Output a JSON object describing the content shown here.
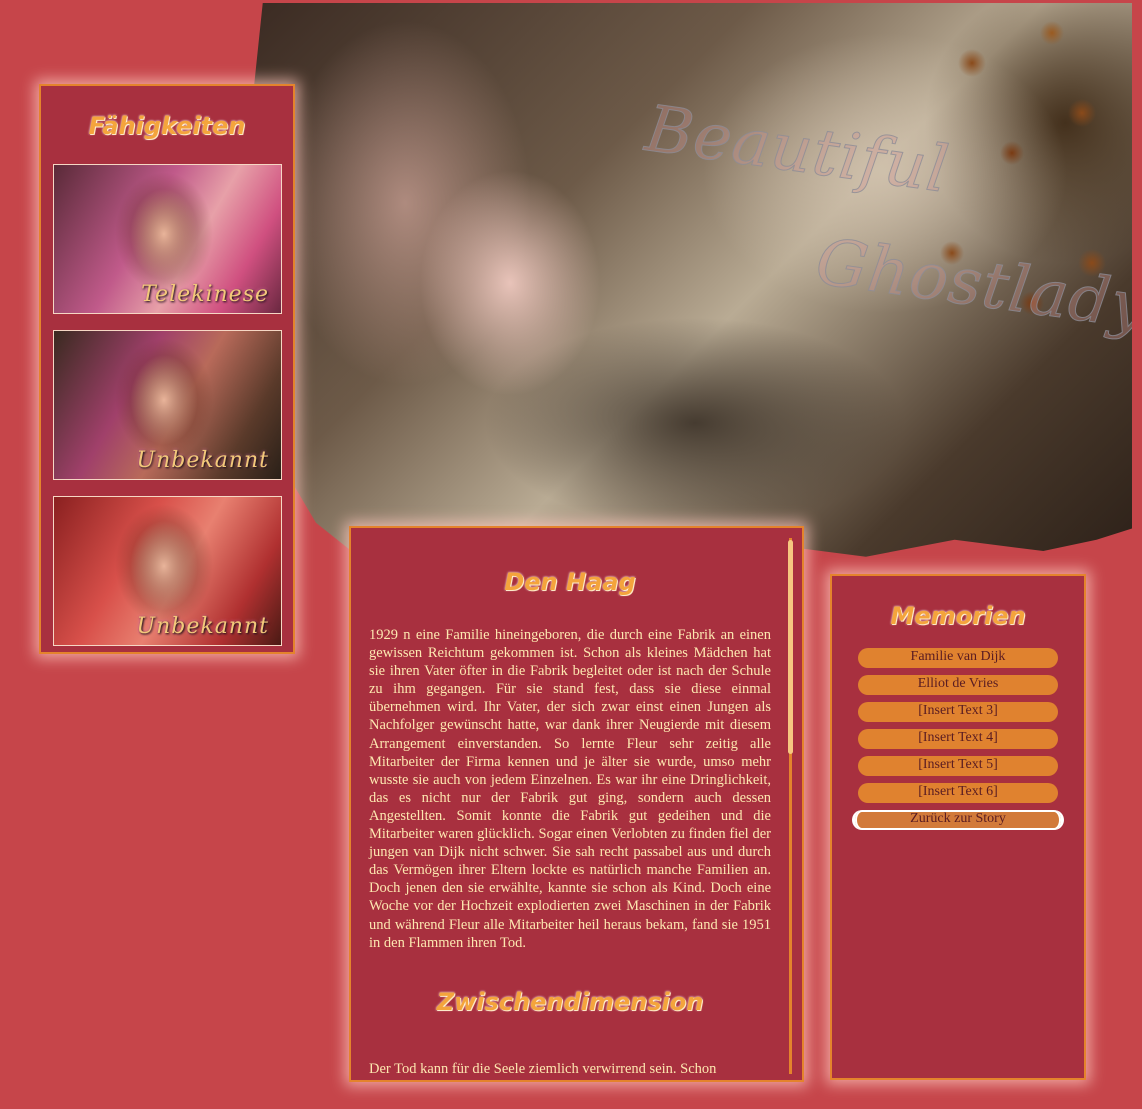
{
  "header": {
    "title_line1": "Beautiful",
    "title_line2": "Ghostlady"
  },
  "left_panel": {
    "title": "Fähigkeiten",
    "abilities": [
      {
        "label": "Telekinese"
      },
      {
        "label": "Unbekannt"
      },
      {
        "label": "Unbekannt"
      }
    ]
  },
  "main": {
    "section1_title": "Den Haag",
    "section1_text": "1929 n eine Familie hineingeboren, die durch eine Fabrik an einen gewissen Reichtum gekommen ist. Schon als kleines Mädchen hat sie ihren Vater öfter in die Fabrik begleitet oder ist nach der Schule zu ihm gegangen. Für sie stand fest, dass sie diese einmal übernehmen wird. Ihr Vater, der sich zwar einst einen Jungen als Nachfolger gewünscht hatte, war dank ihrer Neugierde mit diesem Arrangement einverstanden. So lernte Fleur sehr zeitig alle Mitarbeiter der Firma kennen und je älter sie wurde, umso mehr wusste sie auch von jedem Einzelnen. Es war ihr eine Dringlichkeit, das es nicht nur der Fabrik gut ging, sondern auch dessen Angestellten. Somit konnte die Fabrik gut gedeihen und die Mitarbeiter waren glücklich. Sogar einen Verlobten zu finden fiel der jungen van Dijk nicht schwer. Sie sah recht passabel aus und durch das Vermögen ihrer Eltern lockte es natürlich manche Familien an. Doch jenen den sie erwählte, kannte sie schon als Kind. Doch eine Woche vor der Hochzeit explodierten zwei Maschinen in der Fabrik und während Fleur alle Mitarbeiter heil heraus bekam, fand sie 1951 in den Flammen ihren Tod.",
    "section2_title": "Zwischendimension",
    "section2_text": "Der Tod kann für die Seele ziemlich verwirrend sein. Schon"
  },
  "right_panel": {
    "title": "Memorien",
    "buttons": [
      {
        "label": "Familie van Dijk"
      },
      {
        "label": "Elliot de Vries"
      },
      {
        "label": "[Insert Text 3]"
      },
      {
        "label": "[Insert Text 4]"
      },
      {
        "label": "[Insert Text 5]"
      },
      {
        "label": "[Insert Text 6]"
      }
    ],
    "back_label": "Zurück zur Story"
  },
  "colors": {
    "background": "#c6454a",
    "panel": "#a8303f",
    "accent": "#e4832c",
    "text": "#fde7b0"
  }
}
